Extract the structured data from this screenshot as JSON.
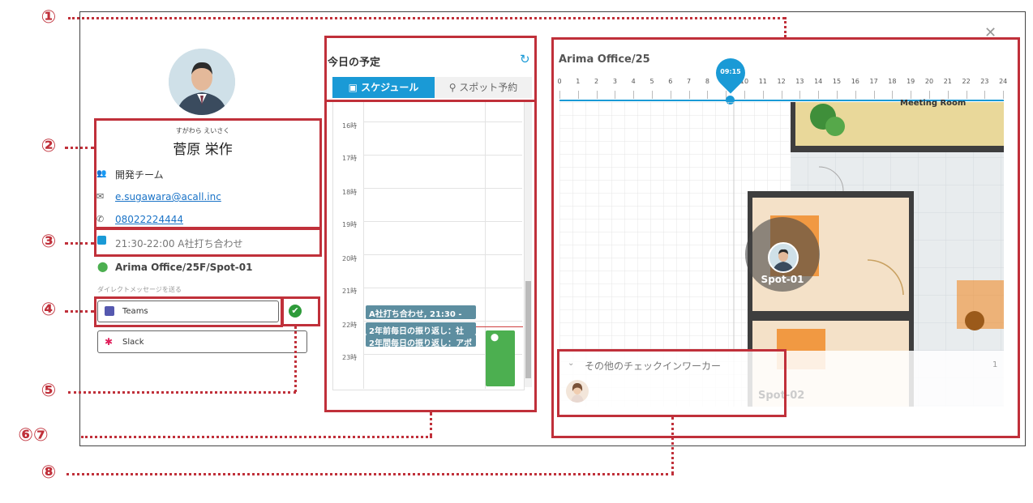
{
  "callouts": [
    "①",
    "②",
    "③",
    "④",
    "⑤",
    "⑥⑦",
    "⑧"
  ],
  "profile": {
    "furigana": "すがわら えいさく",
    "name": "菅原 栄作",
    "team": "開発チーム",
    "email": "e.sugawara@acall.inc",
    "phone": "08022224444",
    "schedule": "21:30-22:00  A社打ち合わせ",
    "location": "Arima Office/25F/Spot-01",
    "dm_label": "ダイレクトメッセージを送る",
    "teams_label": "Teams",
    "slack_label": "Slack"
  },
  "schedule_panel": {
    "title": "今日の予定",
    "tab_schedule": "スケジュール",
    "tab_spot": "スポット予約",
    "hours": [
      "16時",
      "17時",
      "18時",
      "19時",
      "20時",
      "21時",
      "22時",
      "23時"
    ],
    "events": [
      "A社打ち合わせ, 21:30 -",
      "2年前毎日の振り返し：社",
      "2年間毎日の振り返し：アポ"
    ]
  },
  "map": {
    "title": "Arima Office/25",
    "time_marker": "09:15",
    "ticks": [
      "0",
      "1",
      "2",
      "3",
      "4",
      "5",
      "6",
      "7",
      "8",
      "9",
      "10",
      "11",
      "12",
      "13",
      "14",
      "15",
      "16",
      "17",
      "18",
      "19",
      "20",
      "21",
      "22",
      "23",
      "24"
    ],
    "room_label": "Meeting Room",
    "spot1": "Spot-01",
    "spot2": "Spot-02",
    "other_checkin": "その他のチェックインワーカー",
    "other_count": "1"
  },
  "colors": {
    "accent": "#1a9ad6",
    "callout": "#c0303a",
    "event": "#5d8ea0",
    "green": "#4caf50"
  }
}
